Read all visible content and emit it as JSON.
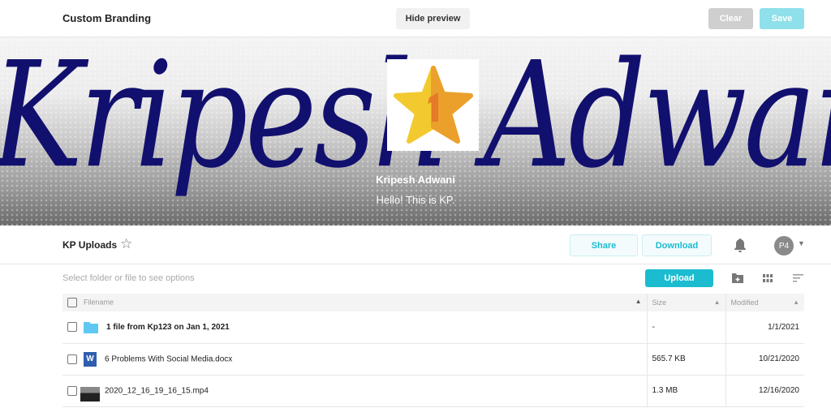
{
  "header": {
    "title": "Custom Branding",
    "hide_preview": "Hide preview",
    "clear": "Clear",
    "save": "Save"
  },
  "banner": {
    "script_text": "Kripesh Adwani",
    "name": "Kripesh Adwani",
    "description": "Hello! This is KP.",
    "logo_icon": "star-number-one-icon"
  },
  "toolbar": {
    "folder_title": "KP Uploads",
    "share": "Share",
    "download": "Download",
    "avatar": "P4"
  },
  "actions": {
    "hint": "Select folder or file to see options",
    "upload": "Upload"
  },
  "table": {
    "columns": [
      "Filename",
      "Size",
      "Modified"
    ],
    "rows": [
      {
        "name": "1 file from Kp123 on Jan 1, 2021",
        "size": "-",
        "modified": "1/1/2021",
        "type": "folder"
      },
      {
        "name": "6 Problems With Social Media.docx",
        "size": "565.7 KB",
        "modified": "10/21/2020",
        "type": "word",
        "icon_letter": "W"
      },
      {
        "name": "2020_12_16_19_16_15.mp4",
        "size": "1.3 MB",
        "modified": "12/16/2020",
        "type": "video"
      }
    ]
  },
  "colors": {
    "accent": "#1bbcd0",
    "script": "#12106e"
  }
}
